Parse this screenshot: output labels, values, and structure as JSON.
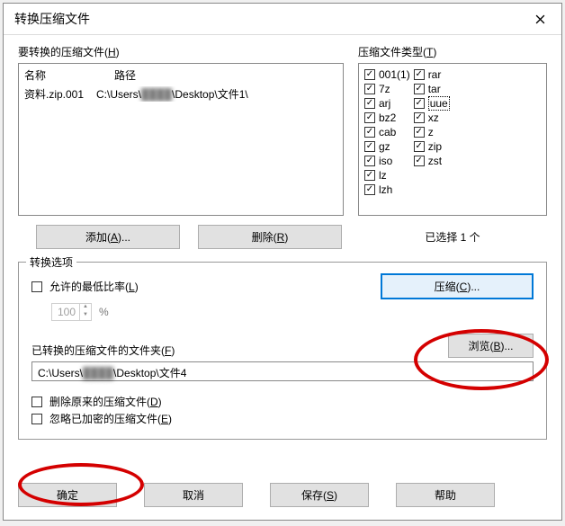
{
  "window": {
    "title": "转换压缩文件"
  },
  "files": {
    "label_pre": "要转换的压缩文件(",
    "label_hot": "H",
    "label_post": ")",
    "col_name": "名称",
    "col_path": "路径",
    "rows": [
      {
        "name": "资料.zip.001",
        "path_pre": "C:\\Users\\",
        "path_blur": "████",
        "path_post": "\\Desktop\\文件1\\"
      }
    ]
  },
  "types": {
    "label_pre": "压缩文件类型(",
    "label_hot": "T",
    "label_post": ")",
    "col1": [
      "001(1)",
      "7z",
      "arj",
      "bz2",
      "cab",
      "gz",
      "iso",
      "lz",
      "lzh"
    ],
    "col2": [
      "rar",
      "tar",
      "uue",
      "xz",
      "z",
      "zip",
      "zst"
    ],
    "highlighted": "uue"
  },
  "buttons": {
    "add_pre": "添加(",
    "add_hot": "A",
    "add_post": ")...",
    "del_pre": "删除(",
    "del_hot": "R",
    "del_post": ")",
    "selected": "已选择 1 个",
    "compress_pre": "压缩(",
    "compress_hot": "C",
    "compress_post": ")...",
    "browse_pre": "浏览(",
    "browse_hot": "B",
    "browse_post": ")...",
    "ok": "确定",
    "cancel": "取消",
    "save_pre": "保存(",
    "save_hot": "S",
    "save_post": ")",
    "help": "帮助"
  },
  "options": {
    "fieldset_label": "转换选项",
    "min_ratio_pre": "允许的最低比率(",
    "min_ratio_hot": "L",
    "min_ratio_post": ")",
    "min_ratio_value": "100",
    "percent": "%",
    "folder_label_pre": "已转换的压缩文件的文件夹(",
    "folder_label_hot": "F",
    "folder_label_post": ")",
    "folder_path_pre": "C:\\Users\\",
    "folder_path_blur": "████",
    "folder_path_post": "\\Desktop\\文件4",
    "delete_orig_pre": "删除原来的压缩文件(",
    "delete_orig_hot": "D",
    "delete_orig_post": ")",
    "skip_enc_pre": "忽略已加密的压缩文件(",
    "skip_enc_hot": "E",
    "skip_enc_post": ")"
  }
}
